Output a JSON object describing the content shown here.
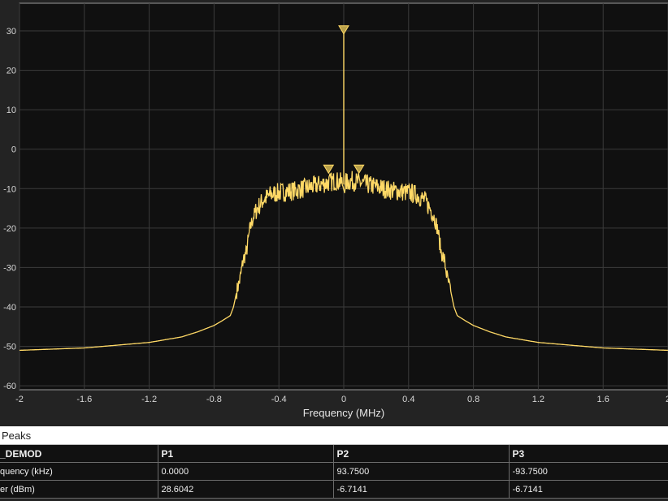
{
  "chart_data": {
    "type": "line",
    "xlabel": "Frequency (MHz)",
    "ylabel": "",
    "xlim": [
      -2,
      2
    ],
    "ylim": [
      -61,
      37
    ],
    "x_ticks": [
      "-2",
      "-1.6",
      "-1.2",
      "-0.8",
      "-0.4",
      "0",
      "0.4",
      "0.8",
      "1.2",
      "1.6",
      "2"
    ],
    "x_tick_values": [
      -2,
      -1.6,
      -1.2,
      -0.8,
      -0.4,
      0,
      0.4,
      0.8,
      1.2,
      1.6,
      2
    ],
    "y_ticks": [
      "30",
      "20",
      "10",
      "0",
      "-10",
      "-20",
      "-30",
      "-40",
      "-50",
      "-60"
    ],
    "y_tick_values": [
      30,
      20,
      10,
      0,
      -10,
      -20,
      -30,
      -40,
      -50,
      -60
    ],
    "grid": true,
    "series": [
      {
        "color": "#ffd966",
        "x": [
          -2,
          -1.6,
          -1.2,
          -1.0,
          -0.9,
          -0.8,
          -0.75,
          -0.7,
          -0.68,
          -0.66,
          -0.64,
          -0.62,
          -0.6,
          -0.58,
          -0.56,
          -0.54,
          -0.5,
          -0.45,
          -0.4,
          -0.3,
          -0.2,
          -0.1,
          -0.05,
          -0.01,
          -0.005,
          0,
          0.005,
          0.01,
          0.05,
          0.1,
          0.2,
          0.3,
          0.4,
          0.45,
          0.5,
          0.54,
          0.56,
          0.58,
          0.6,
          0.62,
          0.64,
          0.66,
          0.68,
          0.7,
          0.75,
          0.8,
          0.9,
          1.0,
          1.2,
          1.6,
          2
        ],
        "y": [
          -51.0,
          -50.4,
          -49.0,
          -47.6,
          -46.3,
          -44.7,
          -43.5,
          -42.2,
          -40.0,
          -36.0,
          -33.0,
          -28.0,
          -26.0,
          -20.5,
          -17.5,
          -15.5,
          -13.0,
          -11.5,
          -11.0,
          -10.5,
          -9.5,
          -8.5,
          -8.0,
          -8.5,
          -9.0,
          29.5,
          -9.0,
          -8.5,
          -8.0,
          -8.5,
          -9.5,
          -10.5,
          -11.0,
          -11.5,
          -13.0,
          -15.5,
          -17.5,
          -20.5,
          -26.0,
          -28.0,
          -33.0,
          -36.0,
          -40.0,
          -42.2,
          -43.5,
          -44.7,
          -46.3,
          -47.6,
          -49.0,
          -50.4,
          -51.0
        ]
      }
    ],
    "markers": [
      {
        "x": 0.0,
        "y": 28.6
      },
      {
        "x": 0.09375,
        "y": -6.7
      },
      {
        "x": -0.09375,
        "y": -6.7
      }
    ]
  },
  "peaks": {
    "title": "Peaks",
    "headers": [
      "_DEMOD",
      "P1",
      "P2",
      "P3"
    ],
    "rows": [
      {
        "name": "quency (kHz)",
        "p1": "0.0000",
        "p2": "93.7500",
        "p3": "-93.7500"
      },
      {
        "name": "er (dBm)",
        "p1": "28.6042",
        "p2": "-6.7141",
        "p3": "-6.7141"
      }
    ]
  }
}
